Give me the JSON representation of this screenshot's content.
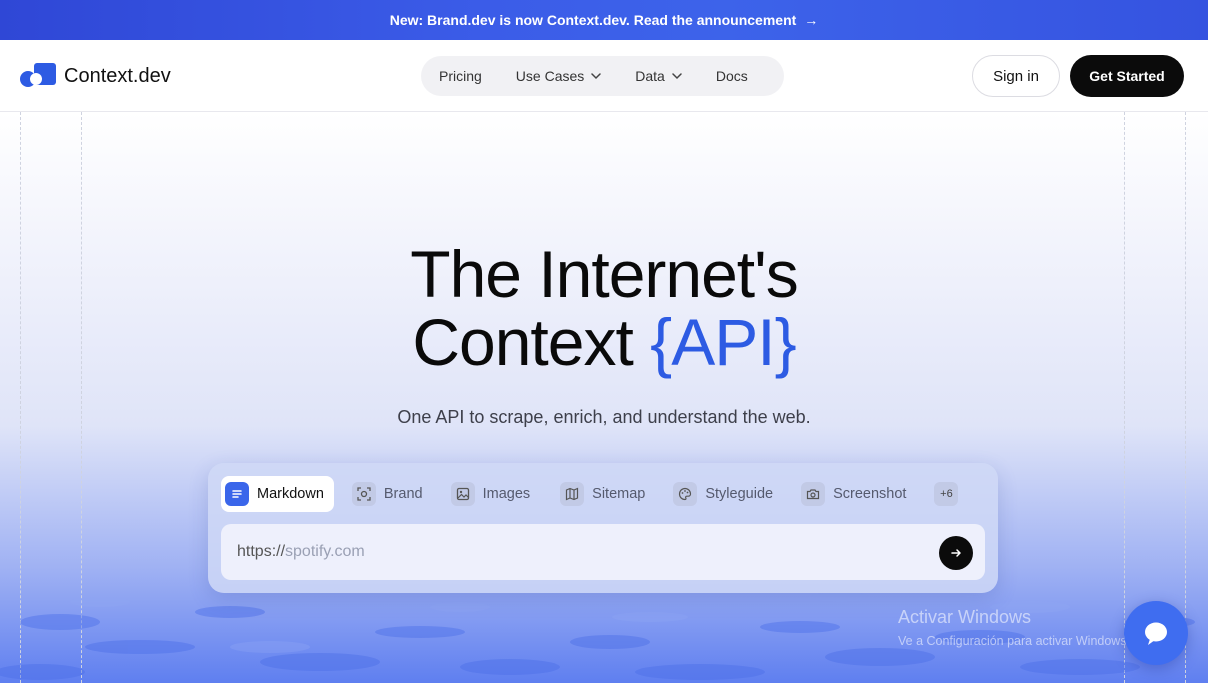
{
  "banner": {
    "text": "New: Brand.dev is now Context.dev. Read the announcement",
    "arrow": "→"
  },
  "nav": {
    "logo_text": "Context.dev",
    "menu": [
      {
        "label": "Pricing",
        "dropdown": false
      },
      {
        "label": "Use Cases",
        "dropdown": true
      },
      {
        "label": "Data",
        "dropdown": true
      },
      {
        "label": "Docs",
        "dropdown": false
      }
    ],
    "signin_label": "Sign in",
    "get_started_label": "Get Started"
  },
  "hero": {
    "title_line1": "The Internet's",
    "title_line2_prefix": "Context ",
    "title_line2_accent": "{API}",
    "subtitle": "One API to scrape, enrich, and understand the web."
  },
  "panel": {
    "tabs": [
      {
        "label": "Markdown",
        "icon": "document-lines-icon",
        "active": true
      },
      {
        "label": "Brand",
        "icon": "focus-target-icon",
        "active": false
      },
      {
        "label": "Images",
        "icon": "image-icon",
        "active": false
      },
      {
        "label": "Sitemap",
        "icon": "map-icon",
        "active": false
      },
      {
        "label": "Styleguide",
        "icon": "palette-icon",
        "active": false
      },
      {
        "label": "Screenshot",
        "icon": "camera-icon",
        "active": false
      }
    ],
    "more_label": "+6",
    "url_prefix": "https://",
    "url_placeholder": "spotify.com"
  },
  "watermark": {
    "line1": "Activar Windows",
    "line2": "Ve a Configuración para activar Windows."
  },
  "colors": {
    "accent": "#2d5be3",
    "banner": "#3b5ce8",
    "dark_button": "#0b0b0b"
  }
}
